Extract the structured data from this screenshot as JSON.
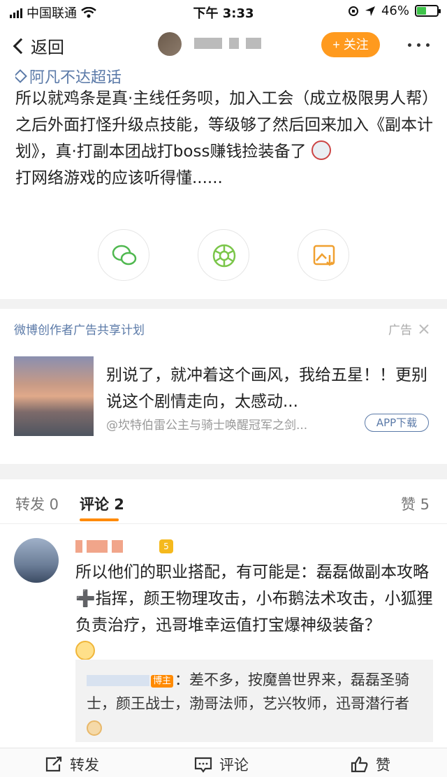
{
  "status_bar": {
    "carrier": "中国联通",
    "time": "下午 3:33",
    "battery": "46%",
    "battery_level": 0.46
  },
  "nav": {
    "back_label": "返回",
    "follow_label": "+ 关注"
  },
  "post": {
    "topic": "阿凡不达超话",
    "text_1": "所以就鸡条是真·主线任务呗，加入工会（成立极限男人帮）之后外面打怪升级点技能，等级够了然后回来加入《副本计划》，真·打副本团战打boss赚钱捡装备了",
    "text_2": "打网络游戏的应该听得懂......"
  },
  "ad": {
    "title": "微博创作者广告共享计划",
    "tag": "广告",
    "text": "别说了，就冲着这个画风，我给五星！！更别说这个剧情走向，太感动...",
    "source": "@坎特伯雷公主与骑士唤醒冠军之剑...",
    "app_button": "APP下载"
  },
  "tabs": {
    "repost": "转发 0",
    "comment": "评论 2",
    "like": "赞 5"
  },
  "comment": {
    "text": "所以他们的职业搭配，有可能是：磊磊做副本攻略➕指挥，颜王物理攻击，小布鹅法术攻击，小狐狸负责治疗，迅哥堆幸运值打宝爆神级装备？",
    "reply_badge": "博主",
    "reply_text": "：差不多，按魔兽世界来，磊磊圣骑士，颜王战士，渤哥法师，艺兴牧师，迅哥潜行者"
  },
  "bottom_bar": {
    "repost": "转发",
    "comment": "评论",
    "like": "赞"
  },
  "colors": {
    "accent": "#ff9a1e",
    "link": "#5b7aa8"
  }
}
